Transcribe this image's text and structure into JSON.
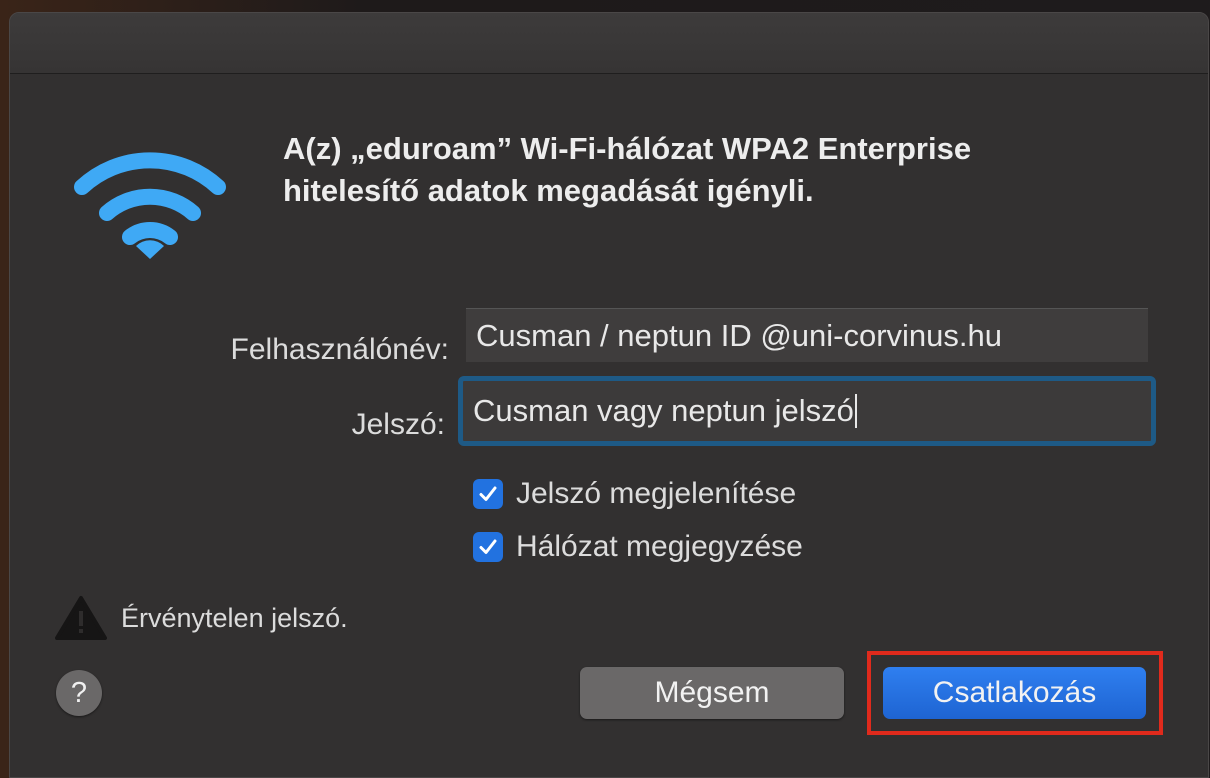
{
  "dialog": {
    "heading_line1": "A(z) „eduroam” Wi-Fi-hálózat WPA2 Enterprise",
    "heading_line2": "hitelesítő adatok megadását igényli.",
    "icon": "wifi-icon",
    "accent_color": "#3fa9f5"
  },
  "form": {
    "username_label": "Felhasználónév:",
    "username_value": "Cusman / neptun ID @uni-corvinus.hu",
    "password_label": "Jelszó:",
    "password_value": "Cusman vagy neptun jelszó",
    "show_password_label": "Jelszó megjelenítése",
    "show_password_checked": true,
    "remember_network_label": "Hálózat megjegyzése",
    "remember_network_checked": true
  },
  "status": {
    "icon": "warning-icon",
    "message": "Érvénytelen jelszó."
  },
  "buttons": {
    "help_label": "?",
    "cancel_label": "Mégsem",
    "connect_label": "Csatlakozás",
    "connect_color": "#2272e0",
    "highlight_color": "#e02a1c"
  }
}
